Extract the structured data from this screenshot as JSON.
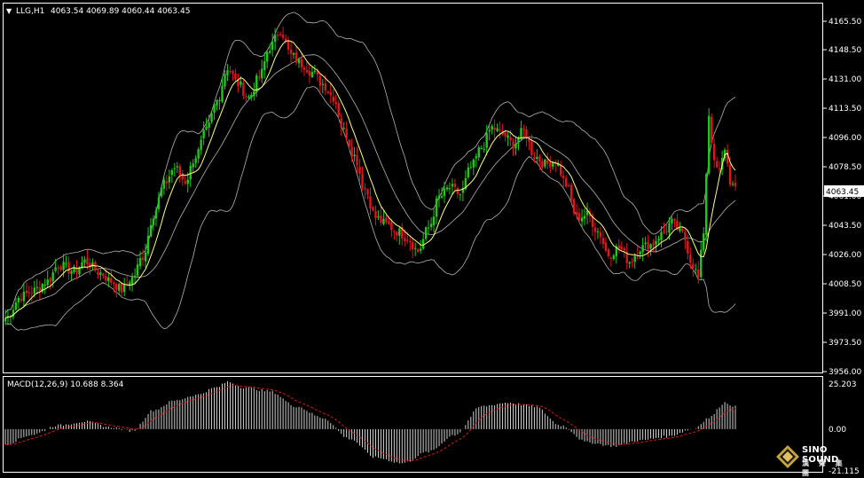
{
  "header": {
    "symbol_label": "LLG,H1",
    "ohlc_label": "4063.54 4069.89 4060.44 4063.45"
  },
  "price_axis": {
    "ticks": [
      "4165.50",
      "4148.50",
      "4131.00",
      "4113.50",
      "4096.00",
      "4078.50",
      "4061.00",
      "4043.50",
      "4026.00",
      "4008.50",
      "3991.00",
      "3973.50",
      "3956.00"
    ],
    "current_price": "4063.45"
  },
  "macd": {
    "label": "MACD(12,26,9) 10.688 8.364",
    "axis_ticks": [
      "25.203",
      "0.00",
      "-21.115"
    ],
    "range": [
      -21.115,
      25.203
    ]
  },
  "colors": {
    "bull": "#22c71d",
    "bear": "#e0151b",
    "ma": "#ffff80",
    "bands": "#b3b3b3",
    "grid_border": "#ffffff",
    "signal": "#e0151b"
  },
  "logo": {
    "name": "SINO SOUND",
    "cn": "漢 聲 集 團"
  },
  "chart_data": {
    "type": "candlestick",
    "title": "LLG,H1",
    "ylim": [
      3956.0,
      4170.0
    ],
    "price_anchors": [
      [
        0,
        3988
      ],
      [
        6,
        4001
      ],
      [
        10,
        4004
      ],
      [
        16,
        4010
      ],
      [
        20,
        4020
      ],
      [
        26,
        4016
      ],
      [
        30,
        4022
      ],
      [
        36,
        4015
      ],
      [
        40,
        4010
      ],
      [
        44,
        4005
      ],
      [
        48,
        4012
      ],
      [
        52,
        4025
      ],
      [
        56,
        4050
      ],
      [
        60,
        4068
      ],
      [
        64,
        4078
      ],
      [
        68,
        4070
      ],
      [
        72,
        4085
      ],
      [
        76,
        4100
      ],
      [
        80,
        4118
      ],
      [
        84,
        4138
      ],
      [
        88,
        4128
      ],
      [
        92,
        4120
      ],
      [
        96,
        4132
      ],
      [
        100,
        4150
      ],
      [
        104,
        4160
      ],
      [
        108,
        4145
      ],
      [
        112,
        4140
      ],
      [
        116,
        4135
      ],
      [
        120,
        4128
      ],
      [
        124,
        4120
      ],
      [
        128,
        4100
      ],
      [
        132,
        4085
      ],
      [
        136,
        4065
      ],
      [
        140,
        4048
      ],
      [
        144,
        4044
      ],
      [
        148,
        4040
      ],
      [
        152,
        4036
      ],
      [
        156,
        4028
      ],
      [
        160,
        4042
      ],
      [
        164,
        4060
      ],
      [
        168,
        4066
      ],
      [
        172,
        4062
      ],
      [
        176,
        4078
      ],
      [
        180,
        4090
      ],
      [
        184,
        4102
      ],
      [
        188,
        4098
      ],
      [
        192,
        4092
      ],
      [
        196,
        4100
      ],
      [
        200,
        4085
      ],
      [
        204,
        4080
      ],
      [
        208,
        4082
      ],
      [
        212,
        4068
      ],
      [
        216,
        4048
      ],
      [
        220,
        4050
      ],
      [
        224,
        4040
      ],
      [
        228,
        4026
      ],
      [
        232,
        4030
      ],
      [
        236,
        4022
      ],
      [
        240,
        4030
      ],
      [
        244,
        4032
      ],
      [
        248,
        4038
      ],
      [
        252,
        4045
      ],
      [
        256,
        4038
      ],
      [
        260,
        4020
      ],
      [
        262,
        4012
      ],
      [
        264,
        4040
      ],
      [
        266,
        4110
      ],
      [
        268,
        4080
      ],
      [
        270,
        4075
      ],
      [
        272,
        4090
      ],
      [
        274,
        4070
      ],
      [
        276,
        4064
      ]
    ],
    "macd_anchors": [
      [
        0,
        -8
      ],
      [
        10,
        -3
      ],
      [
        20,
        2
      ],
      [
        30,
        4
      ],
      [
        40,
        1
      ],
      [
        48,
        -1
      ],
      [
        56,
        10
      ],
      [
        64,
        15
      ],
      [
        72,
        18
      ],
      [
        80,
        22
      ],
      [
        84,
        25
      ],
      [
        90,
        22
      ],
      [
        100,
        20
      ],
      [
        110,
        12
      ],
      [
        120,
        6
      ],
      [
        130,
        -5
      ],
      [
        140,
        -15
      ],
      [
        150,
        -18
      ],
      [
        160,
        -12
      ],
      [
        170,
        -3
      ],
      [
        180,
        12
      ],
      [
        190,
        14
      ],
      [
        200,
        12
      ],
      [
        210,
        2
      ],
      [
        220,
        -7
      ],
      [
        230,
        -9
      ],
      [
        240,
        -6
      ],
      [
        250,
        -4
      ],
      [
        260,
        0
      ],
      [
        266,
        6
      ],
      [
        272,
        14
      ],
      [
        276,
        12
      ]
    ],
    "bar_count": 277
  }
}
